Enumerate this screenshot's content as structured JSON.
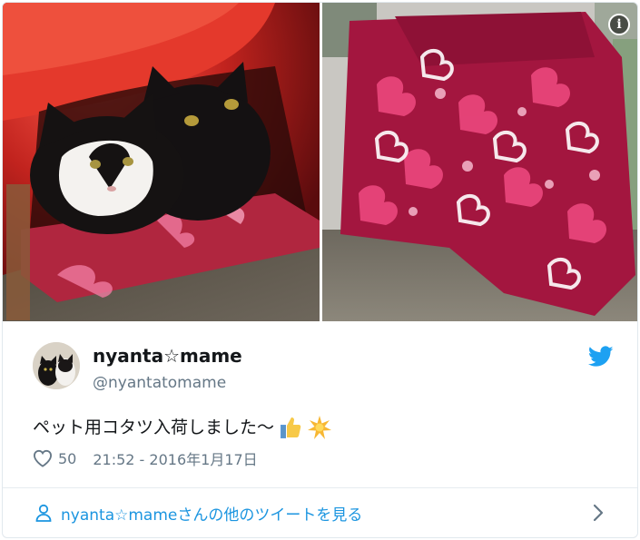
{
  "tweet": {
    "display_name": "nyanta☆mame",
    "handle": "@nyantatomame",
    "text": "ペット用コタツ入荷しました～",
    "likes": "50",
    "timestamp": "21:52 - 2016年1月17日",
    "info_symbol": "i"
  },
  "footer": {
    "more_tweets_label": "nyanta☆mameさんの他のツイートを見る"
  },
  "colors": {
    "link_blue": "#1b95e0",
    "twitter_blue": "#1da1f2",
    "secondary_text": "#657786",
    "quilt_red": "#a3163f",
    "quilt_pink": "#e8457a"
  },
  "icons": {
    "bird": "twitter-bird-icon",
    "heart": "heart-icon",
    "person": "person-icon",
    "chevron": "chevron-right-icon",
    "info": "info-icon"
  }
}
